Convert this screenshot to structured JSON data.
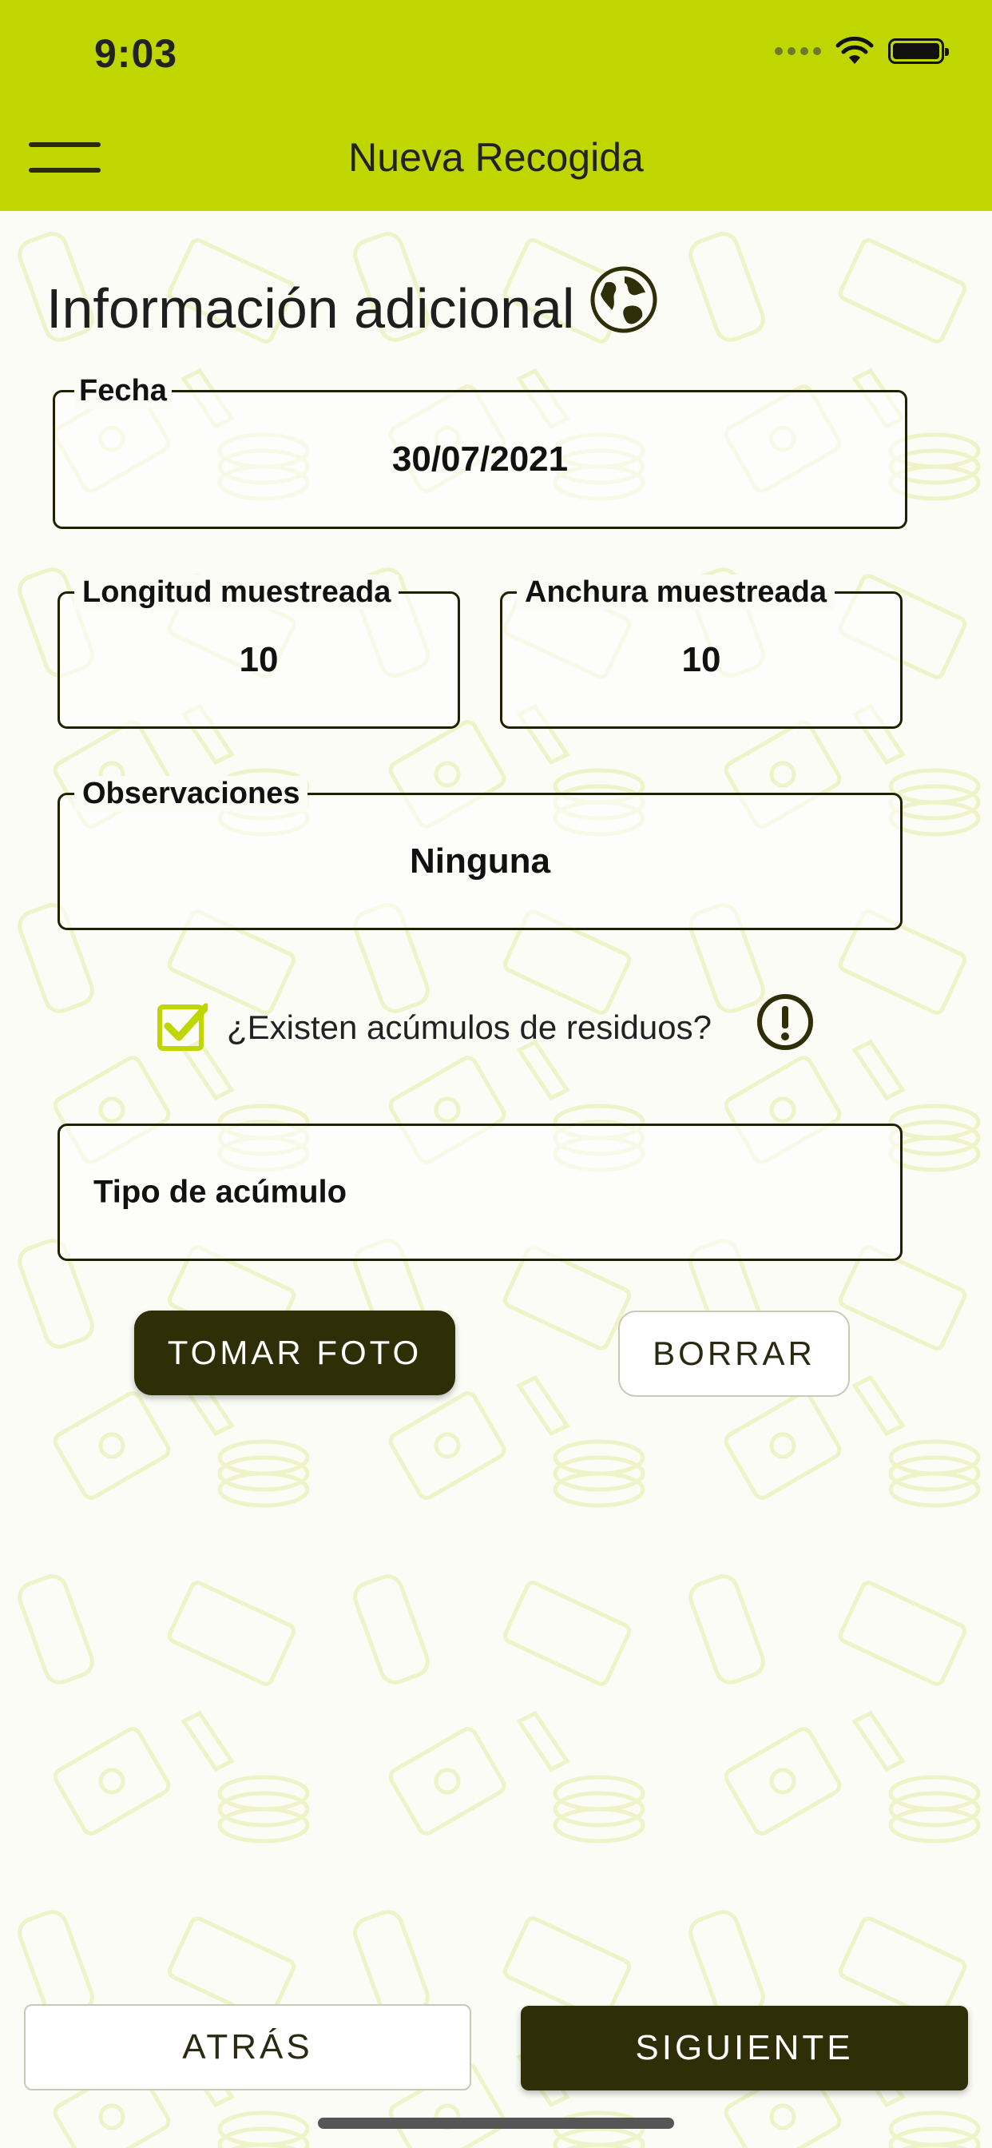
{
  "status_bar": {
    "time": "9:03"
  },
  "header": {
    "title": "Nueva Recogida"
  },
  "section": {
    "title": "Información adicional"
  },
  "fields": {
    "fecha": {
      "label": "Fecha",
      "value": "30/07/2021"
    },
    "longitud": {
      "label": "Longitud muestreada",
      "value": "10"
    },
    "anchura": {
      "label": "Anchura muestreada",
      "value": "10"
    },
    "observaciones": {
      "label": "Observaciones",
      "value": "Ninguna"
    }
  },
  "accumulation": {
    "question": "¿Existen acúmulos de residuos?",
    "checked": true,
    "type_label": "Tipo de acúmulo"
  },
  "buttons": {
    "take_photo": "TOMAR FOTO",
    "delete": "BORRAR",
    "back": "ATRÁS",
    "next": "SIGUIENTE"
  },
  "colors": {
    "accent": "#bfd600",
    "dark": "#2e2e07",
    "check": "#bfd600"
  }
}
